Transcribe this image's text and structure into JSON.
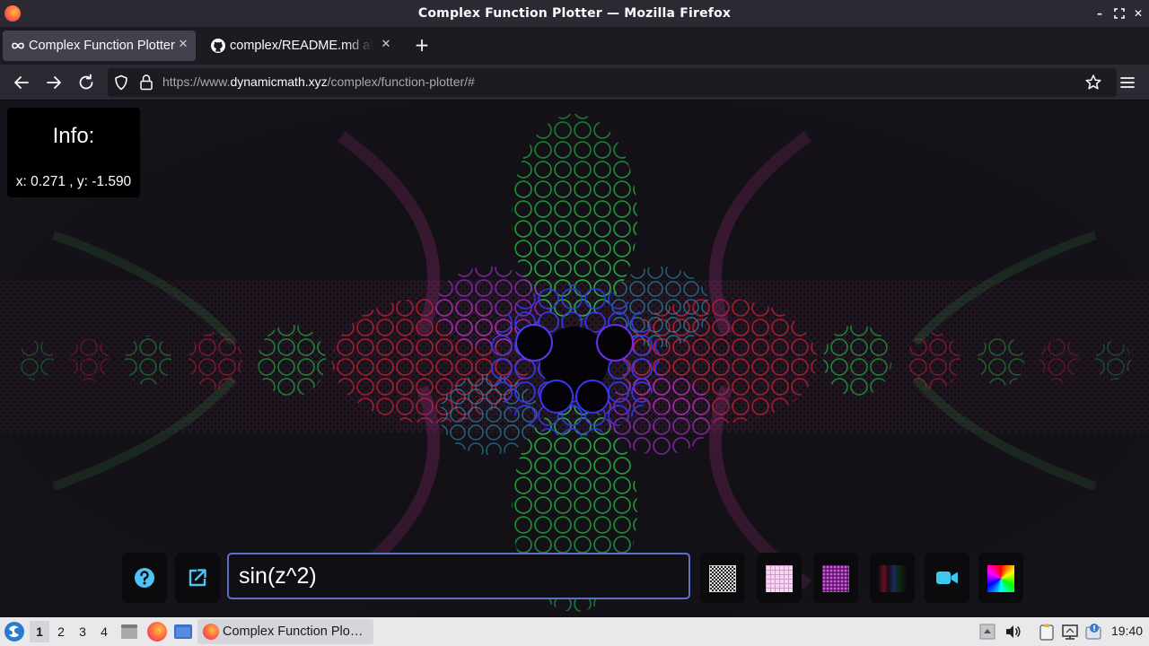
{
  "window": {
    "title": "Complex Function Plotter — Mozilla Firefox"
  },
  "tabs": [
    {
      "label": "Complex Function Plotter",
      "active": true,
      "icon": "infinity-icon"
    },
    {
      "label": "complex/README.md at",
      "active": false,
      "icon": "github-icon"
    }
  ],
  "nav": {
    "url_prefix": "https://www.",
    "url_host": "dynamicmath.xyz",
    "url_path": "/complex/function-plotter/#"
  },
  "info": {
    "title": "Info:",
    "coords": "x: 0.271 , y: -1.590"
  },
  "function_input": {
    "value": "sin(z^2)"
  },
  "toolbar_icons": [
    "help-icon",
    "external-link-icon",
    "pattern-checker-icon",
    "pattern-grid-icon",
    "pattern-dots-icon",
    "pattern-stripes-icon",
    "video-camera-icon",
    "color-wheel-icon"
  ],
  "taskbar": {
    "workspaces": [
      "1",
      "2",
      "3",
      "4"
    ],
    "current_workspace": "1",
    "task_label": "Complex Function Plo…",
    "clock": "19:40"
  },
  "colors": {
    "accent_input_border": "#5f6ec9",
    "plot_background": "#16131a",
    "camera_icon": "#3fc7ef"
  }
}
